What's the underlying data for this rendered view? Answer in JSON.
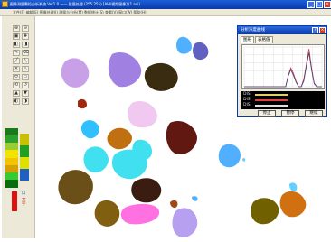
{
  "window": {
    "title": "图像测量颗粒分析系统 Ver1.0 —— 批量处理 (255 255)  [AVI/视频图像] (1.avi)",
    "buttons": [
      "_",
      "□",
      "×"
    ]
  },
  "menubar": {
    "text": "文件(F)  编辑(E)  图像处理(I)  测量与分析(M)  数据统计(S)  查看(V)  窗口(W)  帮助(H)"
  },
  "toolbar": {
    "buttons": [
      "⊕",
      "⊖",
      "▣",
      "✚",
      "◧",
      "◨",
      "✎",
      "⌫",
      "╱",
      "╲",
      "✕",
      "△",
      "⬭",
      "▭",
      "⟲",
      "↺",
      "▲",
      "▼",
      "◐",
      "◑"
    ],
    "palette_colors": [
      "#1a7a1a",
      "#2ba02b",
      "#9acd32",
      "#f2e400",
      "#f2c400",
      "#d6a000",
      "#33cc33",
      "#0c6b0c"
    ],
    "side_colors": [
      "#c8c000",
      "#20a020",
      "#e0e000",
      "#2060c0"
    ],
    "side_value": "口",
    "side_label": "文字",
    "brush_color": "#e01010"
  },
  "dialog": {
    "title": "分析浓度曲线",
    "tabs": [
      "图形",
      "表格值"
    ],
    "legend": [
      {
        "label": "DIS",
        "color": "#e0d060"
      },
      {
        "label": "DIS",
        "color": "#e04040"
      },
      {
        "label": "DIS",
        "color": "#e0e0e0"
      }
    ],
    "buttons": [
      "停止",
      "暂停",
      "继续"
    ]
  },
  "chart_data": {
    "type": "line",
    "title": "",
    "xlabel": "",
    "ylabel": "",
    "series": [
      {
        "values": [
          0,
          0,
          0,
          0,
          0,
          0,
          0,
          0,
          0,
          0,
          0,
          0,
          0,
          0,
          0,
          0,
          0,
          0.3,
          0.5,
          0.35,
          0.15,
          0,
          0,
          0.2,
          0.6,
          1.0,
          0.5,
          0.1,
          0,
          0,
          0
        ],
        "color": "#d04040"
      },
      {
        "values": [
          0,
          0,
          0,
          0,
          0,
          0,
          0,
          0,
          0,
          0,
          0,
          0,
          0,
          0,
          0,
          0,
          0,
          0.28,
          0.45,
          0.3,
          0.12,
          0,
          0,
          0.15,
          0.55,
          0.9,
          0.45,
          0.08,
          0,
          0,
          0
        ],
        "color": "#404080"
      }
    ],
    "ylim": [
      0,
      1.05
    ],
    "grid": true
  },
  "particles": [
    {
      "color": "#c8a0e8",
      "name": "lilac"
    },
    {
      "color": "#a080e0",
      "name": "violet"
    },
    {
      "color": "#3a2c10",
      "name": "dark-olive"
    },
    {
      "color": "#50b0ff",
      "name": "sky-blue"
    },
    {
      "color": "#6060c0",
      "name": "periwinkle"
    },
    {
      "color": "#a02810",
      "name": "rust"
    },
    {
      "color": "#f0c8f0",
      "name": "pink"
    },
    {
      "color": "#30c0ff",
      "name": "azure"
    },
    {
      "color": "#c07010",
      "name": "ochre"
    },
    {
      "color": "#601810",
      "name": "maroon"
    },
    {
      "color": "#40e0f0",
      "name": "cyan"
    },
    {
      "color": "#7a5410",
      "name": "bronze"
    },
    {
      "color": "#806010",
      "name": "olive-brown"
    },
    {
      "color": "#3a1c10",
      "name": "dark-brown"
    },
    {
      "color": "#ff60d0",
      "name": "pink-magenta"
    },
    {
      "color": "#a04818",
      "name": "brown"
    },
    {
      "color": "#ffa0f0",
      "name": "pink-pale"
    },
    {
      "color": "#b8a0f0",
      "name": "lavender"
    },
    {
      "color": "#706000",
      "name": "olive"
    },
    {
      "color": "#d07010",
      "name": "orange"
    },
    {
      "color": "#60d0ff",
      "name": "light-blue"
    }
  ]
}
